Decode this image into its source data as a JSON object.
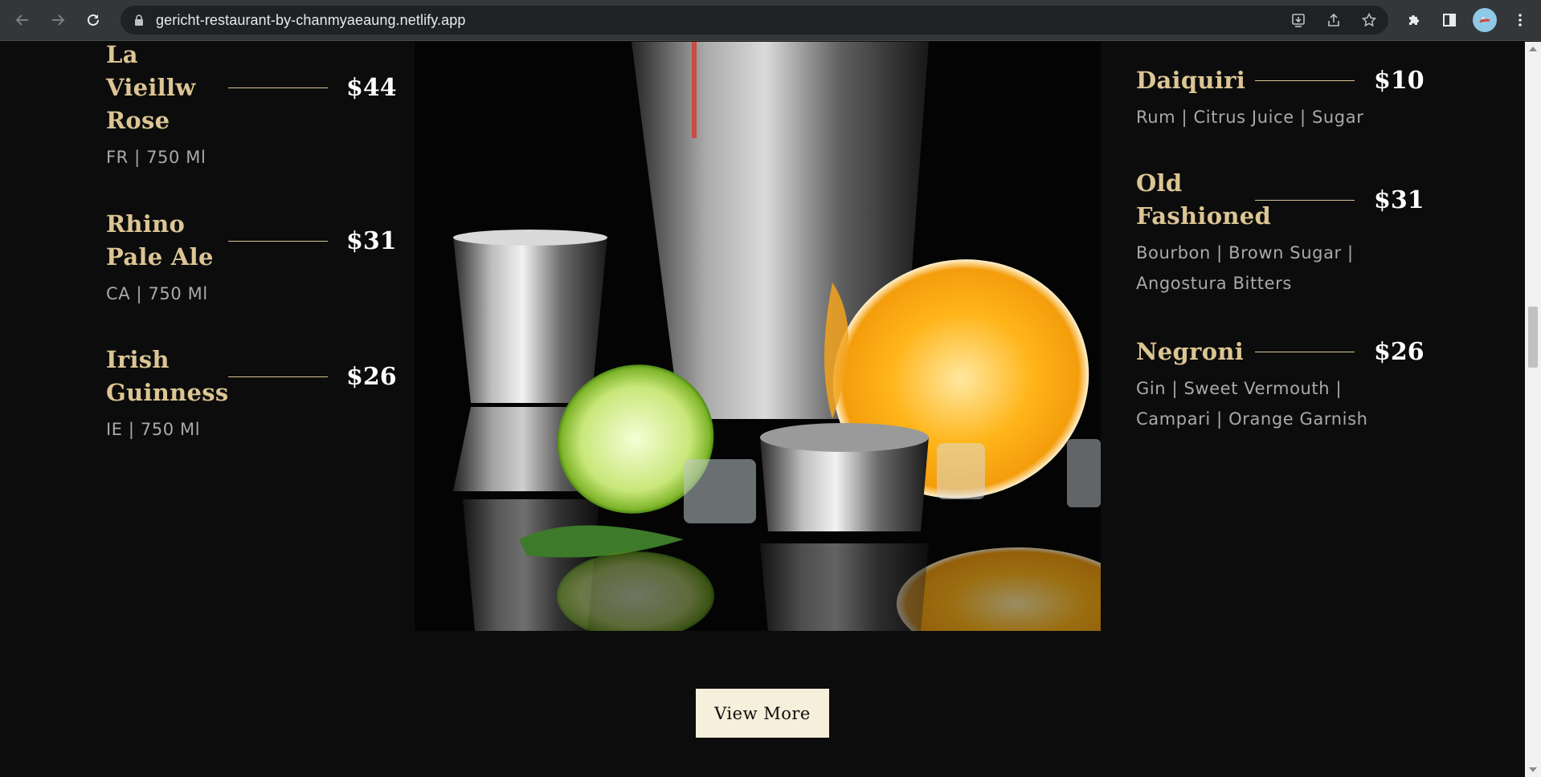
{
  "browser": {
    "url": "gericht-restaurant-by-chanmyaeaung.netlify.app"
  },
  "colors": {
    "accent_gold": "#dcc594",
    "background": "#0c0c0c",
    "button_bg": "#f5efdb"
  },
  "left_items": [
    {
      "name": "La Vieillw Rose",
      "price": "$44",
      "desc": "FR | 750 Ml"
    },
    {
      "name": "Rhino Pale Ale",
      "price": "$31",
      "desc": "CA | 750 Ml"
    },
    {
      "name": "Irish Guinness",
      "price": "$26",
      "desc": "IE | 750 Ml"
    }
  ],
  "right_items": [
    {
      "name": "Daiquiri",
      "price": "$10",
      "desc": "Rum | Citrus Juice | Sugar"
    },
    {
      "name": "Old Fashioned",
      "price": "$31",
      "desc": "Bourbon | Brown Sugar | Angostura Bitters"
    },
    {
      "name": "Negroni",
      "price": "$26",
      "desc": "Gin | Sweet Vermouth | Campari | Orange Garnish"
    }
  ],
  "cta": {
    "label": "View More"
  },
  "icons": {
    "back": "arrow-left-icon",
    "forward": "arrow-right-icon",
    "reload": "reload-icon",
    "lock": "lock-icon",
    "install": "install-icon",
    "share": "share-icon",
    "bookmark": "star-icon",
    "extensions": "puzzle-icon",
    "side_panel": "side-panel-icon",
    "menu": "kebab-menu-icon"
  }
}
